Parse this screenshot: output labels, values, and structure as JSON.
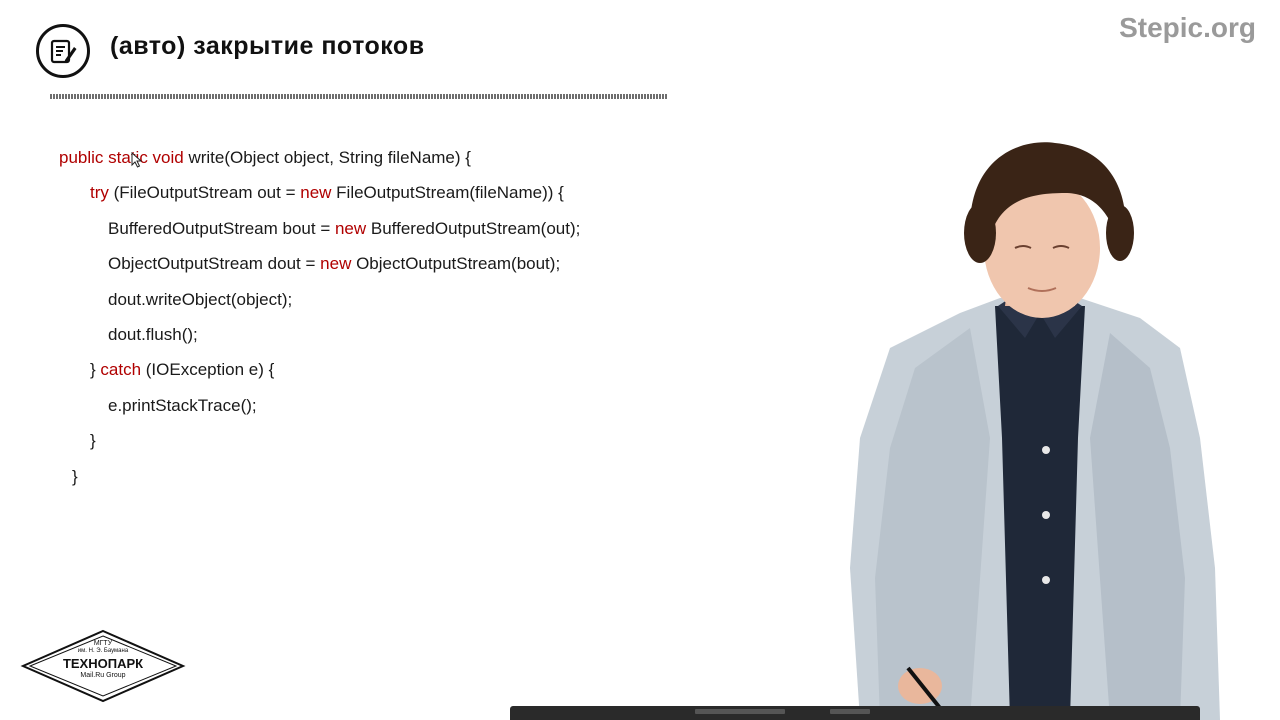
{
  "header": {
    "title": "(авто) закрытие потоков",
    "brand": "Stepic.org",
    "title_icon": "notepad-pencil-icon"
  },
  "code": {
    "lines": [
      [
        {
          "t": "public static void ",
          "kw": true
        },
        {
          "t": "write(Object object, String fileName) {",
          "kw": false
        }
      ],
      [
        {
          "t": "try ",
          "kw": true
        },
        {
          "t": "(FileOutputStream out = ",
          "kw": false
        },
        {
          "t": "new ",
          "kw": true
        },
        {
          "t": "FileOutputStream(fileName)) {",
          "kw": false
        }
      ],
      [
        {
          "t": "BufferedOutputStream bout = ",
          "kw": false
        },
        {
          "t": "new ",
          "kw": true
        },
        {
          "t": "BufferedOutputStream(out);",
          "kw": false
        }
      ],
      [
        {
          "t": "ObjectOutputStream dout = ",
          "kw": false
        },
        {
          "t": "new ",
          "kw": true
        },
        {
          "t": "ObjectOutputStream(bout);",
          "kw": false
        }
      ],
      [
        {
          "t": "dout.writeObject(object);",
          "kw": false
        }
      ],
      [
        {
          "t": "dout.flush();",
          "kw": false
        }
      ],
      [
        {
          "t": "} ",
          "kw": false
        },
        {
          "t": "catch ",
          "kw": true
        },
        {
          "t": "(IOException e) {",
          "kw": false
        }
      ],
      [
        {
          "t": "e.printStackTrace();",
          "kw": false
        }
      ],
      [
        {
          "t": "}",
          "kw": false
        }
      ],
      [
        {
          "t": "}",
          "kw": false
        }
      ]
    ],
    "keyword_color": "#b00000",
    "text_color": "#1a1a1a"
  },
  "logo": {
    "line1": "МГТУ",
    "line2": "им. Н. Э. Баумана",
    "line3": "ТЕХНОПАРК",
    "line4": "Mail.Ru Group"
  },
  "presenter": {
    "description_icon": "presenter-video"
  }
}
